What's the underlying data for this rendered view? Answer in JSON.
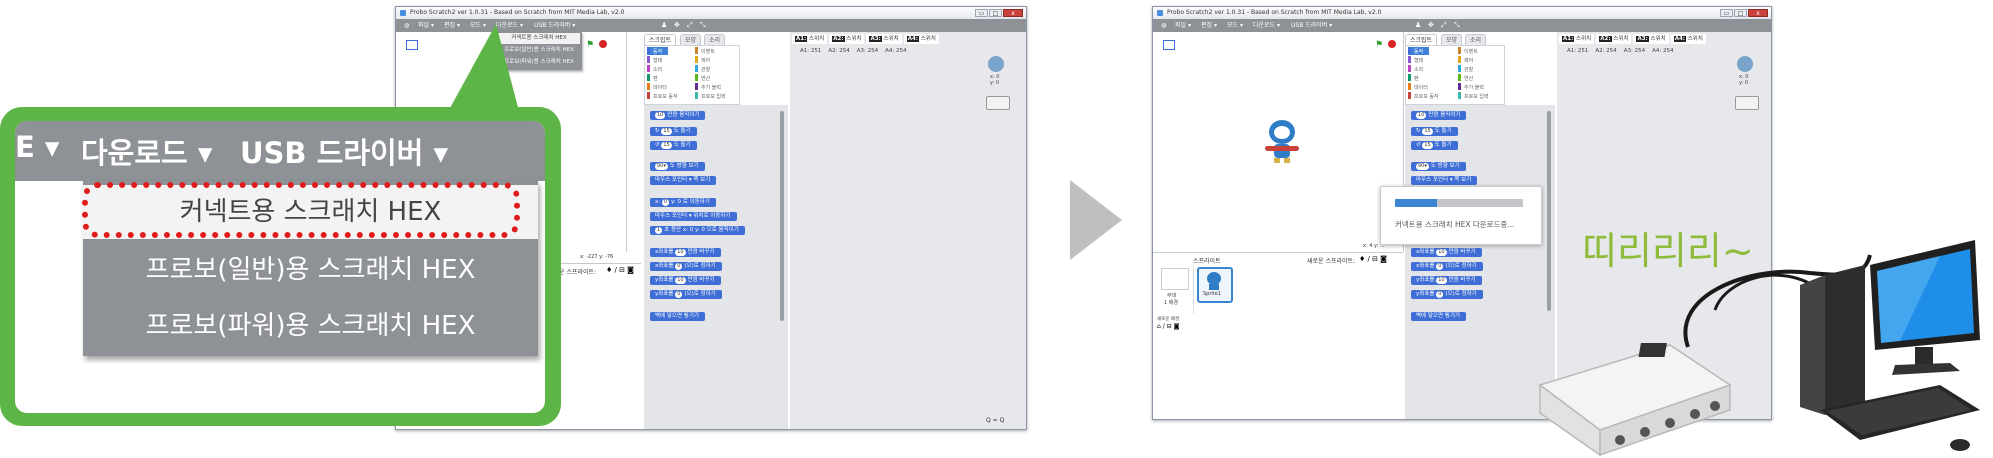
{
  "window": {
    "title": "Probo Scratch2 ver 1.0.31 - Based on Scratch from MIT Media Lab, v2.0",
    "controls": [
      "▭",
      "□",
      "x"
    ]
  },
  "menu": {
    "items": [
      "파일 ▾",
      "편집 ▾",
      "모드 ▾",
      "다운로드 ▾",
      "USB 드라이버 ▾"
    ],
    "toolbar_icons": [
      "person-icon",
      "move-icon",
      "grow-icon",
      "shrink-icon"
    ]
  },
  "download_menu": {
    "options": [
      "커넥트용 스크래치 HEX",
      "프로보(일반)용 스크래치 HEX",
      "프로보(파워)용 스크래치 HEX"
    ]
  },
  "zoom_callout": {
    "bar_left": "E ▾",
    "bar_download": "다운로드 ▾",
    "bar_usb": "USB 드라이버 ▾",
    "highlight_color": "#e01b1b",
    "frame_color": "#5cb546"
  },
  "tabs": [
    "스크립트",
    "모양",
    "소리"
  ],
  "categories": {
    "left": [
      {
        "label": "동작",
        "color": "#3f6fd6",
        "selected": true
      },
      {
        "label": "형태",
        "color": "#8a55d7",
        "selected": false
      },
      {
        "label": "소리",
        "color": "#bb42c3",
        "selected": false
      },
      {
        "label": "펜",
        "color": "#0e9a6c",
        "selected": false
      },
      {
        "label": "데이터",
        "color": "#ee7d16",
        "selected": false
      },
      {
        "label": "프로보 동작",
        "color": "#c8413a",
        "selected": false
      }
    ],
    "right": [
      {
        "label": "이벤트",
        "color": "#c88330"
      },
      {
        "label": "제어",
        "color": "#e1a91a"
      },
      {
        "label": "관찰",
        "color": "#2ca5e2"
      },
      {
        "label": "연산",
        "color": "#5cb712"
      },
      {
        "label": "추가 블럭",
        "color": "#632d99"
      },
      {
        "label": "프로보 입력",
        "color": "#3fb8b0"
      }
    ]
  },
  "blocks": [
    {
      "num": "10",
      "text": "만큼 움직이기"
    },
    {
      "num": "15",
      "text": "도 돌기",
      "pre": "↻"
    },
    {
      "num": "15",
      "text": "도 돌기",
      "pre": "↺"
    },
    {
      "num": "90▾",
      "text": "도 방향 보기"
    },
    {
      "num": "",
      "text": "마우스 포인터 ▾ 쪽 보기"
    },
    {
      "num": "0",
      "text": "y: 0 로 이동하기",
      "pre": "x:"
    },
    {
      "num": "",
      "text": "마우스 포인터 ▾ 위치로 이동하기"
    },
    {
      "num": "1",
      "text": "초 동안 x: 0 y: 0 으로 움직이기"
    },
    {
      "num": "10",
      "text": "만큼 바꾸기",
      "pre": "x좌표를"
    },
    {
      "num": "0",
      "text": "(으)로 정하기",
      "pre": "x좌표를"
    },
    {
      "num": "10",
      "text": "만큼 바꾸기",
      "pre": "y좌표를"
    },
    {
      "num": "0",
      "text": "(으)로 정하기",
      "pre": "y좌표를"
    },
    {
      "num": "",
      "text": "벽에 닿으면 튕기기"
    }
  ],
  "sensors": {
    "tabs": [
      {
        "key": "A1:",
        "label": "스위치"
      },
      {
        "key": "A2:",
        "label": "스위치"
      },
      {
        "key": "A3:",
        "label": "스위치"
      },
      {
        "key": "A4:",
        "label": "스위치"
      }
    ],
    "values": [
      "A1: 251",
      "A2: 254",
      "A3: 254",
      "A4: 254"
    ]
  },
  "sprite": {
    "panel_label": "스프라이트",
    "new_sprite_label": "새로운 스프라이트:",
    "sprite_name": "Sprite1",
    "stage_label": "무대",
    "stage_sub": "1 배경",
    "new_backdrop": "새로운 배경",
    "coords_xy": "x: 0\ny: 0",
    "mouse_xy_left": "x: -227  y: -76",
    "mouse_xy_right": "x: 4  y: ..."
  },
  "progress": {
    "message": "커넥트용 스크래치 HEX 다운로드중...",
    "fraction": 0.33,
    "fill_color": "#3a85d1"
  },
  "sound_text": "띠리리리~",
  "zoom_controls": "Q = Q"
}
